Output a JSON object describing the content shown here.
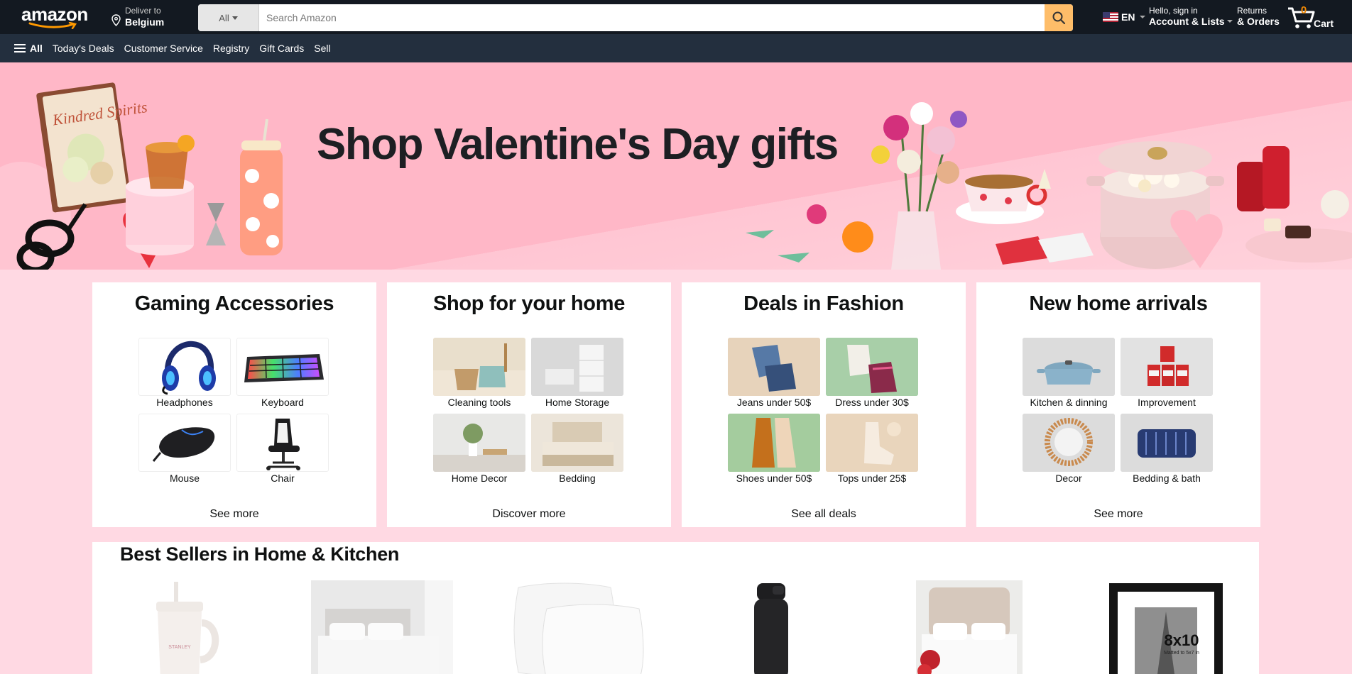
{
  "header": {
    "logo_text": "amazon",
    "deliver_to": "Deliver to",
    "deliver_location": "Belgium",
    "search_category": "All",
    "search_placeholder": "Search Amazon",
    "language": "EN",
    "greeting": "Hello, sign in",
    "account_label": "Account & Lists",
    "returns": "Returns",
    "orders": "& Orders",
    "cart_count": "0",
    "cart_label": "Cart"
  },
  "subnav": {
    "all": "All",
    "items": [
      "Today's Deals",
      "Customer Service",
      "Registry",
      "Gift Cards",
      "Sell"
    ]
  },
  "hero": {
    "title": "Shop Valentine's Day gifts",
    "book_title": "Kindred Spirits"
  },
  "cards": [
    {
      "title": "Gaming Accessories",
      "tiles": [
        {
          "label": "Headphones",
          "icon": "headphones-icon"
        },
        {
          "label": "Keyboard",
          "icon": "keyboard-icon"
        },
        {
          "label": "Mouse",
          "icon": "mouse-icon"
        },
        {
          "label": "Chair",
          "icon": "chair-icon"
        }
      ],
      "link": "See more"
    },
    {
      "title": "Shop for your home",
      "tiles": [
        {
          "label": "Cleaning tools"
        },
        {
          "label": "Home Storage"
        },
        {
          "label": "Home Decor"
        },
        {
          "label": "Bedding"
        }
      ],
      "link": "Discover more"
    },
    {
      "title": "Deals in Fashion",
      "tiles": [
        {
          "label": "Jeans under 50$"
        },
        {
          "label": "Dress under 30$"
        },
        {
          "label": "Shoes under 50$"
        },
        {
          "label": "Tops under 25$"
        }
      ],
      "link": "See all deals"
    },
    {
      "title": "New home arrivals",
      "tiles": [
        {
          "label": "Kitchen & dinning"
        },
        {
          "label": "Improvement"
        },
        {
          "label": "Decor"
        },
        {
          "label": "Bedding & bath"
        }
      ],
      "link": "See more"
    }
  ],
  "best_sellers": {
    "title": "Best Sellers in Home & Kitchen",
    "tumbler_brand": "STANLEY",
    "frame_size": "8x10",
    "frame_caption": "Matted to 5x7 in"
  },
  "colors": {
    "header_bg": "#131921",
    "subnav_bg": "#232f3e",
    "search_button": "#febd69",
    "page_bg": "#ffd9e3",
    "hero_pink": "#ffb7c7"
  }
}
